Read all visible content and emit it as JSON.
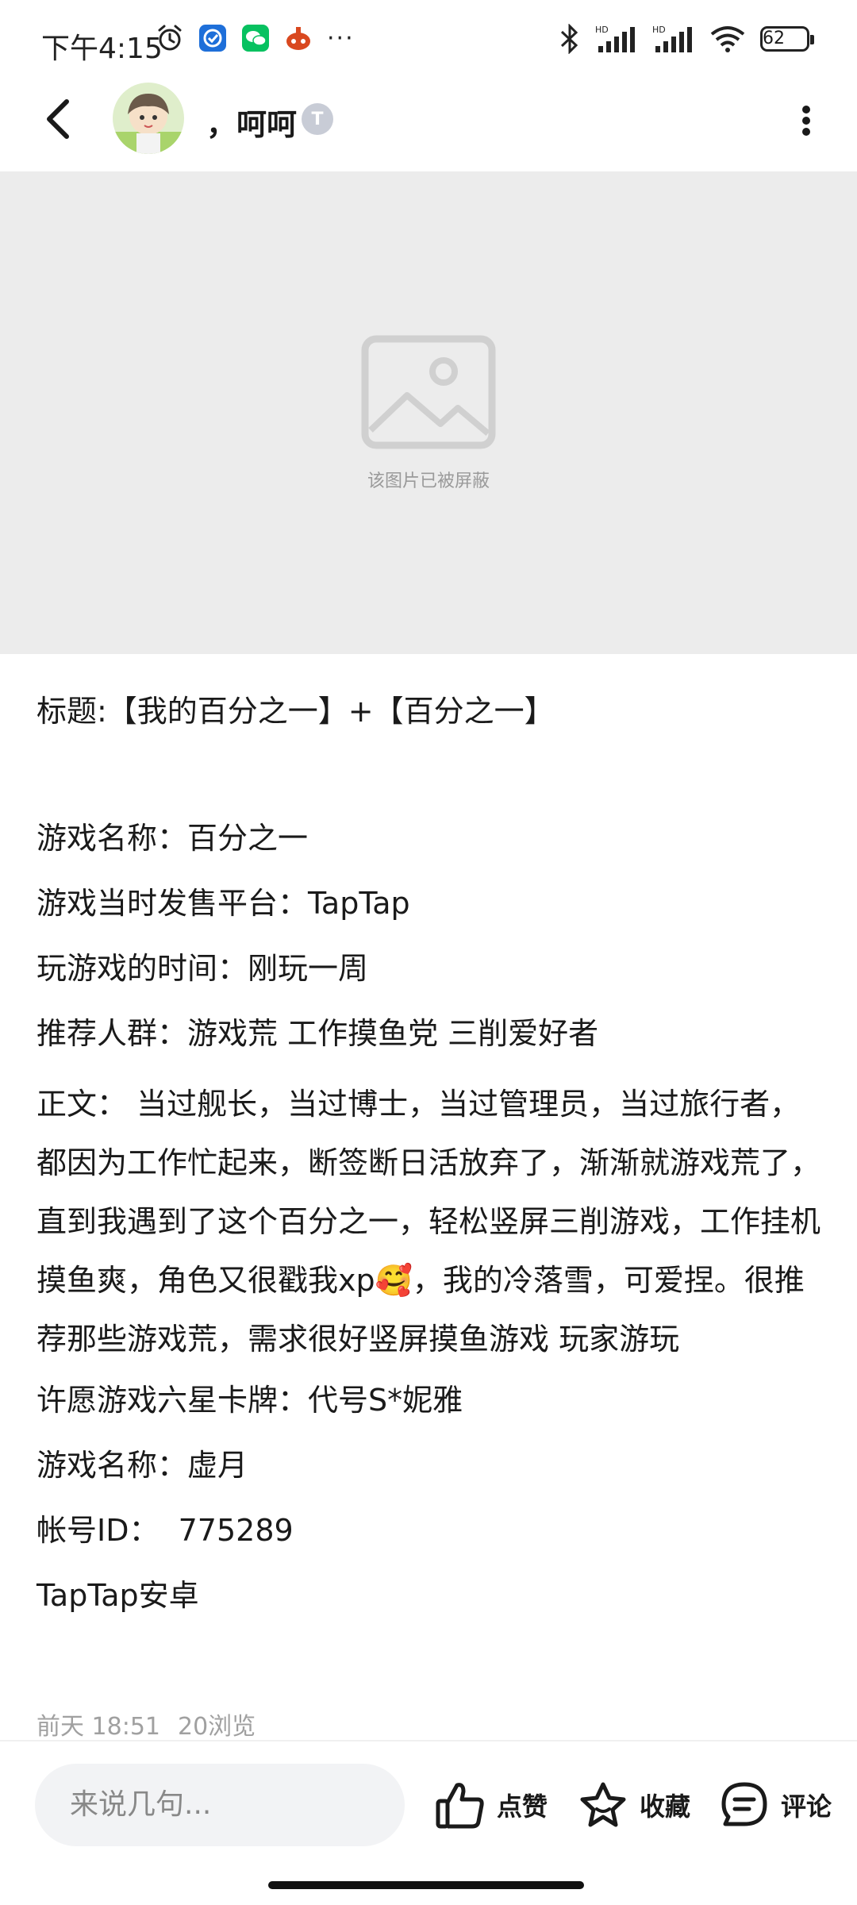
{
  "status_bar": {
    "time": "下午4:15",
    "overflow": "···",
    "battery": "62",
    "icons": [
      "alarm-icon",
      "app-icon",
      "wechat-icon",
      "game-icon",
      "bluetooth-icon",
      "signal-icon",
      "signal-icon",
      "wifi-icon",
      "battery-icon"
    ]
  },
  "nav": {
    "username": "，呵呵",
    "level_badge": "T"
  },
  "blocked_image": {
    "text": "该图片已被屏蔽"
  },
  "post": {
    "title_line": "标题:【我的百分之一】+【百分之一】",
    "game_name": "游戏名称：百分之一",
    "platform": "游戏当时发售平台：TapTap",
    "play_time": "玩游戏的时间：刚玩一周",
    "audience": "推荐人群：游戏荒 工作摸鱼党 三削爱好者",
    "body": "正文：  当过舰长，当过博士，当过管理员，当过旅行者，都因为工作忙起来，断签断日活放弃了，渐渐就游戏荒了，直到我遇到了这个百分之一，轻松竖屏三削游戏，工作挂机摸鱼爽，角色又很戳我xp🥰，我的冷落雪，可爱捏。很推荐那些游戏荒，需求很好竖屏摸鱼游戏 玩家游玩",
    "wish_card": "许愿游戏六星卡牌：代号S*妮雅",
    "wish_game": "游戏名称：虚月",
    "account_id": "帐号ID：  775289",
    "store": "TapTap安卓",
    "time": "前天 18:51",
    "views": "20浏览"
  },
  "bottom_bar": {
    "comment_placeholder": "来说几句...",
    "like_label": "点赞",
    "favorite_label": "收藏",
    "comment_label": "评论"
  }
}
